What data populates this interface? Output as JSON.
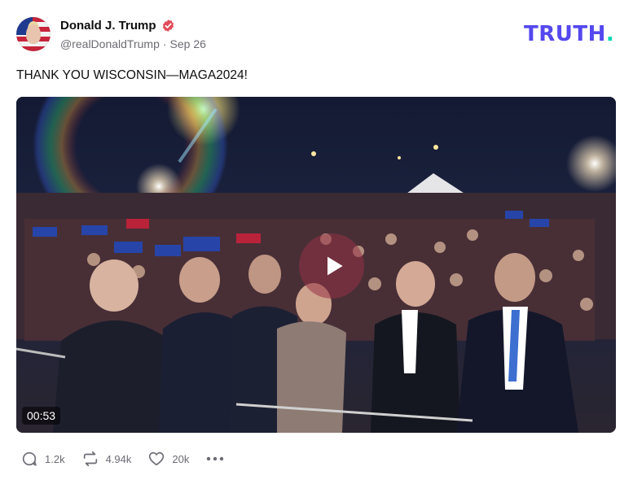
{
  "author": {
    "display_name": "Donald J. Trump",
    "handle": "@realDonaldTrump",
    "date": "Sep 26",
    "separator": "·",
    "verified_color": "#e24c5b"
  },
  "brand": {
    "logo_text": "TRUTH",
    "logo_period": ".",
    "primary_color": "#5448ee",
    "accent_color": "#00d6b3"
  },
  "post": {
    "text": "THANK YOU WISCONSIN—MAGA2024!"
  },
  "media": {
    "type": "video",
    "duration": "00:53",
    "play_icon": "play-icon"
  },
  "actions": {
    "replies": "1.2k",
    "retruths": "4.94k",
    "likes": "20k",
    "reply_icon": "speech-bubble-icon",
    "retruth_icon": "repost-arrows-icon",
    "like_icon": "heart-icon",
    "more_icon": "ellipsis-icon"
  }
}
